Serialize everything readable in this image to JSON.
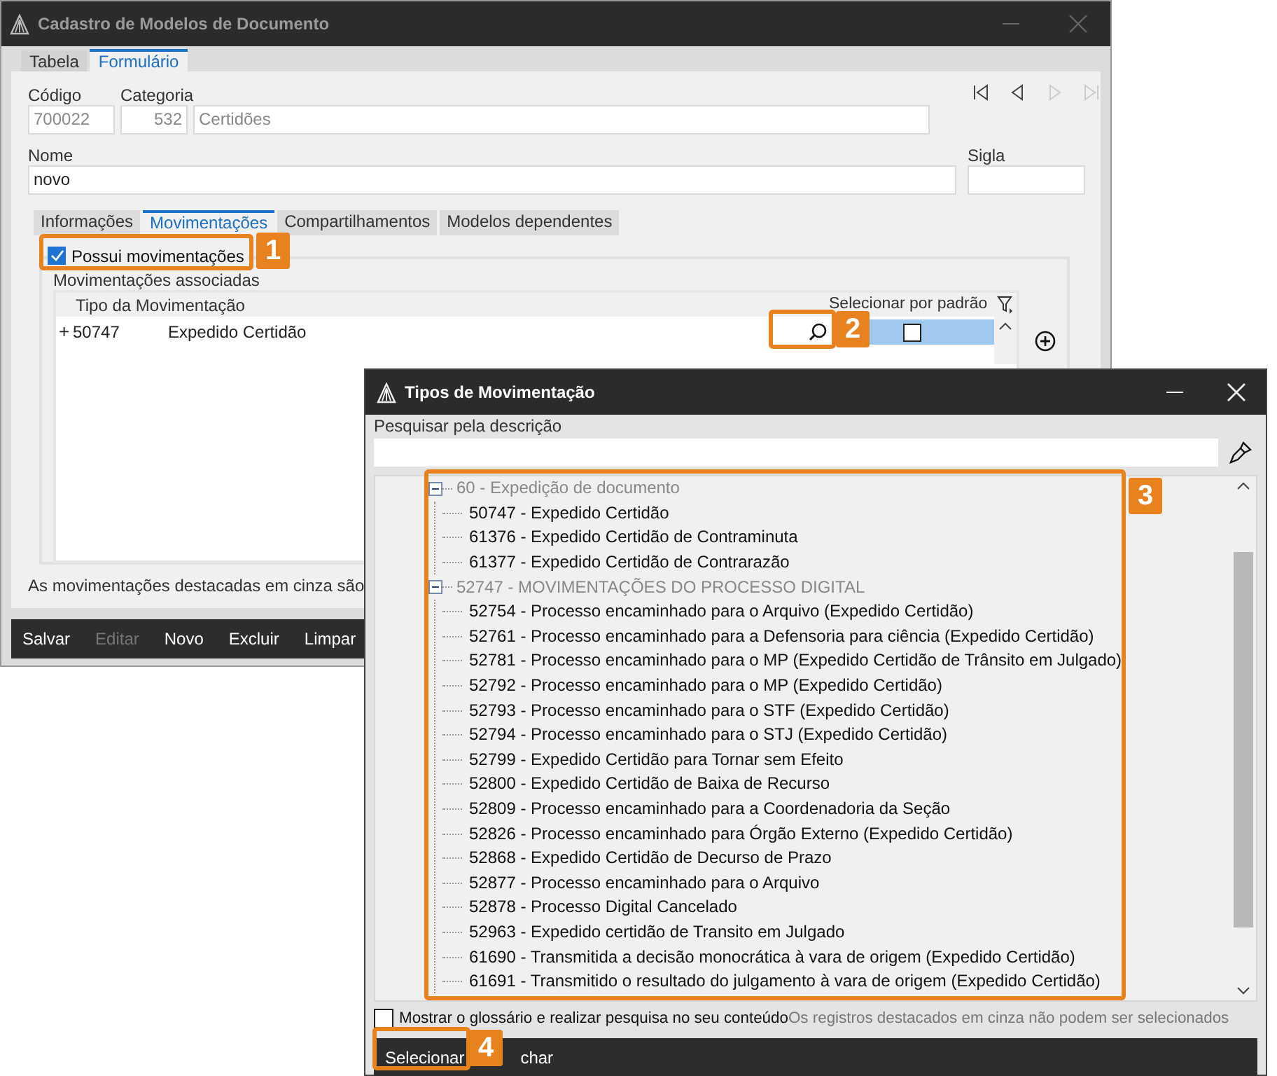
{
  "main_window": {
    "title": "Cadastro de Modelos de Documento",
    "tabs": [
      {
        "label": "Tabela",
        "selected": false
      },
      {
        "label": "Formulário",
        "selected": true
      }
    ],
    "navigation": [
      {
        "kind": "first",
        "disabled": false
      },
      {
        "kind": "prev",
        "disabled": false
      },
      {
        "kind": "next",
        "disabled": true
      },
      {
        "kind": "last",
        "disabled": true
      }
    ],
    "fields": {
      "codigo": {
        "label": "Código",
        "value": "700022"
      },
      "categoria": {
        "label": "Categoria",
        "code": "532",
        "value": "Certidões"
      },
      "nome": {
        "label": "Nome",
        "value": "novo"
      },
      "sigla": {
        "label": "Sigla"
      }
    },
    "inner_tabs": [
      {
        "label": "Informações",
        "selected": false
      },
      {
        "label": "Movimentações",
        "selected": true
      },
      {
        "label": "Compartilhamentos",
        "selected": false
      },
      {
        "label": "Modelos dependentes",
        "selected": false
      }
    ],
    "possui": {
      "label": "Possui movimentações",
      "checked": true
    },
    "group_title": "Movimentações associadas",
    "grid": {
      "columns": [
        "Tipo da Movimentação",
        "Selecionar por padrão"
      ],
      "rows": [
        {
          "expander": "+",
          "code": "50747",
          "description": "Expedido Certidão",
          "default_checked": false,
          "selected": true
        }
      ]
    },
    "footer_note": "As movimentações destacadas em cinza são",
    "toolbar": [
      {
        "label": "Salvar",
        "disabled": false
      },
      {
        "label": "Editar",
        "disabled": true
      },
      {
        "label": "Novo",
        "disabled": false
      },
      {
        "label": "Excluir",
        "disabled": false
      },
      {
        "label": "Limpar",
        "disabled": false
      }
    ]
  },
  "dialog": {
    "title": "Tipos de Movimentação",
    "search": {
      "label": "Pesquisar pela descrição"
    },
    "tree": [
      {
        "label": "60 - Expedição de documento",
        "expanded": true,
        "disabled": true,
        "children": [
          {
            "label": "50747 - Expedido Certidão"
          },
          {
            "label": "61376 - Expedido Certidão de Contraminuta"
          },
          {
            "label": "61377 - Expedido Certidão de Contrarazão"
          }
        ]
      },
      {
        "label": "52747 - MOVIMENTAÇÕES DO PROCESSO DIGITAL",
        "expanded": true,
        "disabled": true,
        "children": [
          {
            "label": "52754 - Processo encaminhado para o Arquivo (Expedido Certidão)"
          },
          {
            "label": "52761 - Processo encaminhado para a Defensoria para ciência (Expedido Certidão)"
          },
          {
            "label": "52781 - Processo encaminhado para o MP (Expedido Certidão de Trânsito em Julgado)"
          },
          {
            "label": "52792 - Processo encaminhado para o MP (Expedido Certidão)"
          },
          {
            "label": "52793 - Processo encaminhado para o STF (Expedido Certidão)"
          },
          {
            "label": "52794 - Processo encaminhado para o STJ (Expedido Certidão)"
          },
          {
            "label": "52799 - Expedido Certidão para Tornar sem Efeito"
          },
          {
            "label": "52800 - Expedido Certidão de Baixa de Recurso"
          },
          {
            "label": "52809 - Processo encaminhado para a Coordenadoria da Seção"
          },
          {
            "label": "52826 - Processo encaminhado para Órgão Externo (Expedido Certidão)"
          },
          {
            "label": "52868 - Expedido Certidão de Decurso de Prazo"
          },
          {
            "label": "52877 - Processo encaminhado para o Arquivo"
          },
          {
            "label": "52878 - Processo Digital Cancelado"
          },
          {
            "label": "52963 - Expedido certidão de Transito em Julgado"
          },
          {
            "label": "61690 - Transmitida a decisão monocrática à vara de origem (Expedido Certidão)"
          },
          {
            "label": "61691 - Transmitido o resultado do julgamento à vara de origem (Expedido Certidão)"
          }
        ]
      }
    ],
    "glossary": {
      "label": "Mostrar o glossário e realizar pesquisa no seu conteúdo",
      "checked": false
    },
    "note": "Os registros destacados em cinza não podem ser selecionados",
    "buttons": [
      {
        "label": "Selecionar"
      },
      {
        "label": "char"
      }
    ]
  },
  "callouts": [
    {
      "label": "1"
    },
    {
      "label": "2"
    },
    {
      "label": "3"
    },
    {
      "label": "4"
    }
  ]
}
